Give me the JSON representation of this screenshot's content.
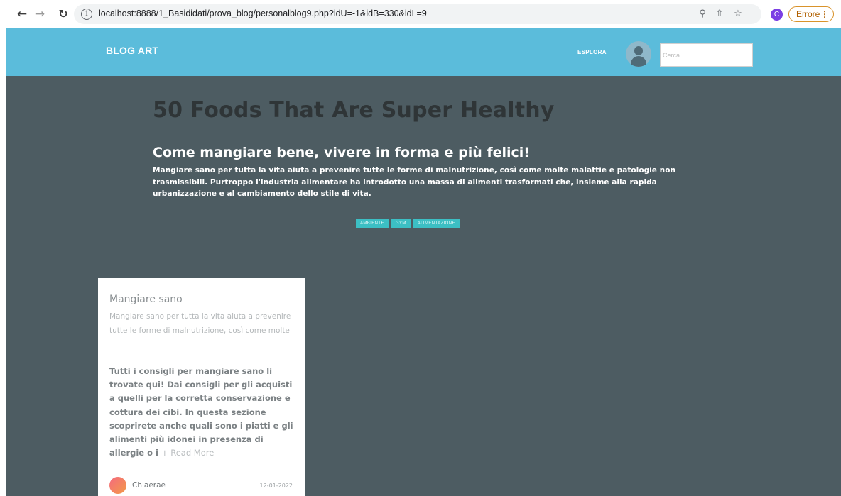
{
  "browser": {
    "url_host": "localhost",
    "url_rest": ":8888/1_Basididati/prova_blog/personalblog9.php?idU=-1&idB=330&idL=9",
    "profile_initial": "C",
    "error_label": "Errore"
  },
  "header": {
    "brand": "BLOG ART",
    "nav_label": "ESPLORA",
    "search_placeholder": "Cerca..."
  },
  "hero": {
    "title": "50 Foods That Are Super Healthy",
    "subtitle": "Come mangiare bene, vivere in forma e più felici!",
    "description": "Mangiare sano per tutta la vita aiuta a prevenire tutte le forme di malnutrizione, così come molte malattie e patologie non trasmissibili. Purtroppo l'industria alimentare ha introdotto una massa di alimenti trasformati che, insieme alla rapida urbanizzazione e al cambiamento dello stile di vita.",
    "tags": [
      "AMBIENTE",
      "GYM",
      "ALIMENTAZIONE"
    ]
  },
  "card": {
    "title": "Mangiare sano",
    "excerpt": "Mangiare sano per tutta la vita aiuta a prevenire tutte le forme di malnutrizione, così come molte",
    "body": "Tutti i consigli per mangiare sano li trovate qui! Dai consigli per gli acquisti a quelli per la corretta conservazione e cottura dei cibi. In questa sezione scoprirete anche quali sono i piatti e gli alimenti più idonei in presenza di allergie o i",
    "read_more": "+ Read More",
    "author": "Chiaerae",
    "date": "12-01-2022"
  }
}
